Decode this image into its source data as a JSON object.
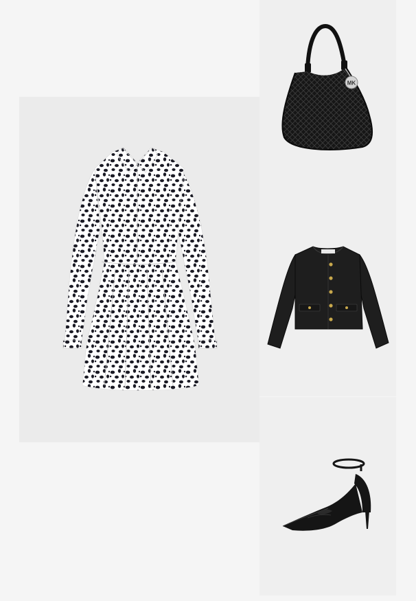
{
  "outfit": {
    "items": [
      {
        "id": "dress",
        "icon": "leopard-print-shirt-dress-image",
        "colors": {
          "base": "#ffffff",
          "print": "#1a1a24"
        }
      },
      {
        "id": "bag",
        "icon": "black-woven-hobo-bag-image",
        "logo_text": "MK",
        "colors": {
          "base": "#161616",
          "hardware": "#c9c9c9"
        }
      },
      {
        "id": "jacket",
        "icon": "black-leather-collarless-jacket-image",
        "colors": {
          "base": "#1e1e1e",
          "buttons": "#c8a84c"
        }
      },
      {
        "id": "shoe",
        "icon": "black-ankle-strap-pointed-pump-image",
        "colors": {
          "base": "#151515"
        }
      }
    ]
  }
}
